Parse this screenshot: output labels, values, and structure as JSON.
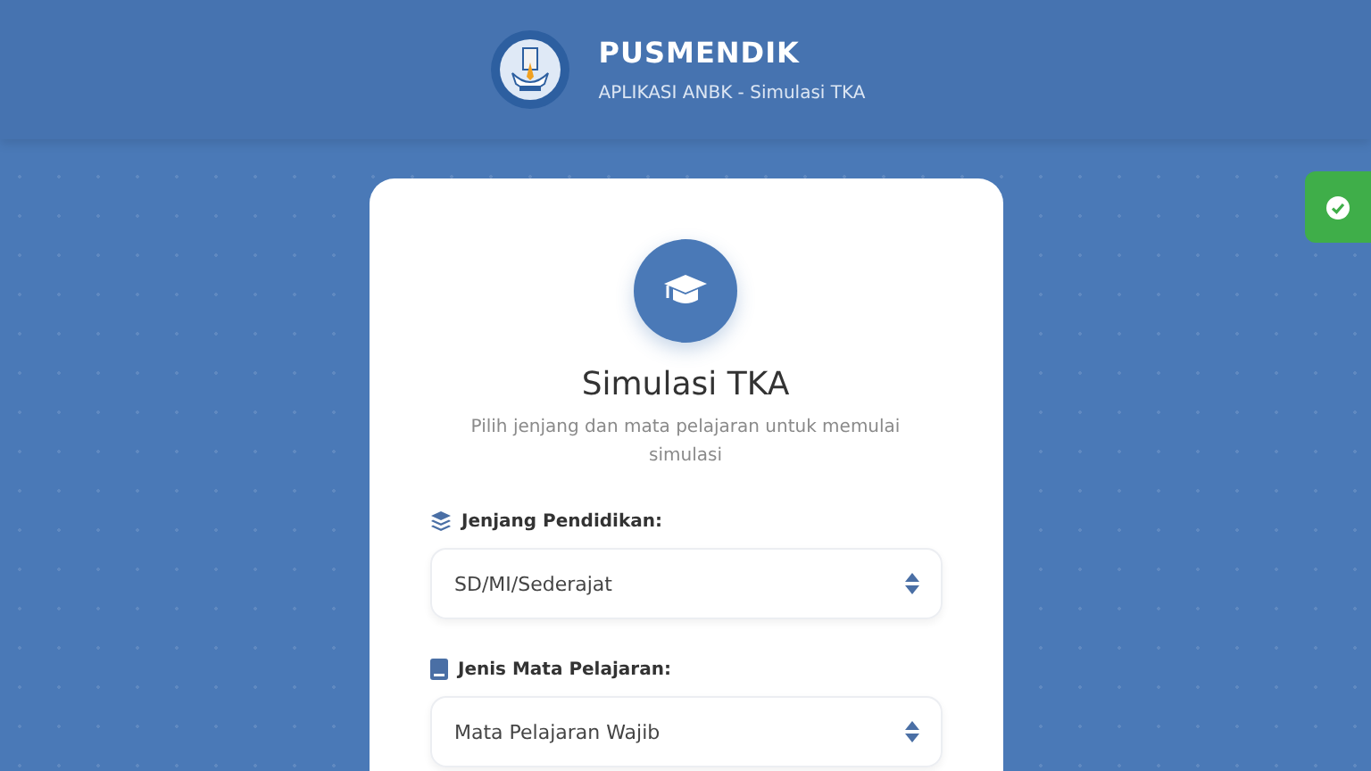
{
  "header": {
    "title": "PUSMENDIK",
    "subtitle": "APLIKASI ANBK - Simulasi TKA"
  },
  "card": {
    "title": "Simulasi TKA",
    "description": "Pilih jenjang dan mata pelajaran untuk memulai simulasi",
    "fields": [
      {
        "kind": "layers",
        "label": "Jenjang Pendidikan:",
        "value": "SD/MI/Sederajat"
      },
      {
        "kind": "book",
        "label": "Jenis Mata Pelajaran:",
        "value": "Mata Pelajaran Wajib"
      }
    ]
  },
  "toast": {
    "kind": "success"
  }
}
